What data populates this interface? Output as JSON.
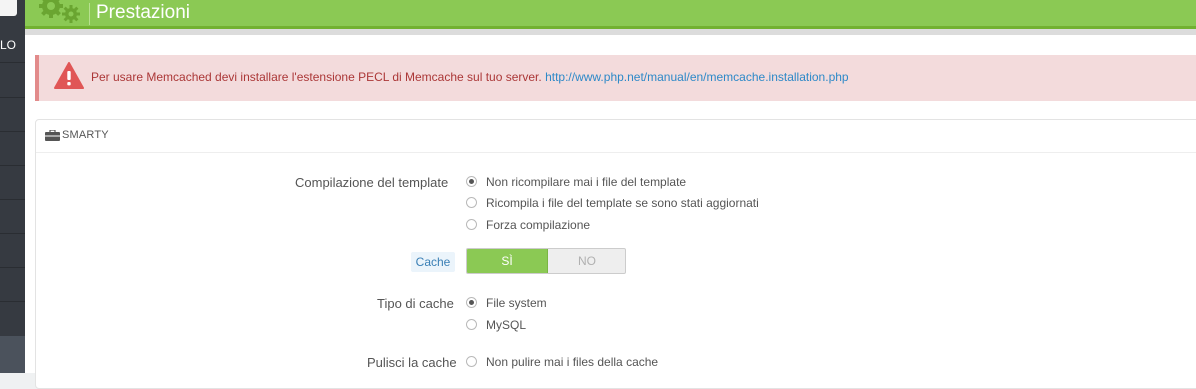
{
  "sidebar": {
    "label": "LO"
  },
  "header": {
    "title": "Prestazioni",
    "accent": "#8bc954"
  },
  "alert": {
    "text": "Per usare Memcached devi installare l'estensione PECL di Memcache sul tuo server.",
    "link": "http://www.php.net/manual/en/memcache.installation.php",
    "icon": "warning-icon"
  },
  "panel": {
    "title": "SMARTY",
    "icon": "briefcase-icon"
  },
  "form": {
    "template_compilation": {
      "label": "Compilazione del template",
      "options": [
        {
          "label": "Non ricompilare mai i file del template",
          "checked": true
        },
        {
          "label": "Ricompila i file del template se sono stati aggiornati",
          "checked": false
        },
        {
          "label": "Forza compilazione",
          "checked": false
        }
      ]
    },
    "cache": {
      "label": "Cache",
      "yes_label": "SÌ",
      "no_label": "NO",
      "value": "SÌ"
    },
    "cache_type": {
      "label": "Tipo di cache",
      "options": [
        {
          "label": "File system",
          "checked": true
        },
        {
          "label": "MySQL",
          "checked": false
        }
      ]
    },
    "clear_cache": {
      "label": "Pulisci la cache",
      "options": [
        {
          "label": "Non pulire mai i files della cache",
          "checked": false
        }
      ]
    }
  }
}
